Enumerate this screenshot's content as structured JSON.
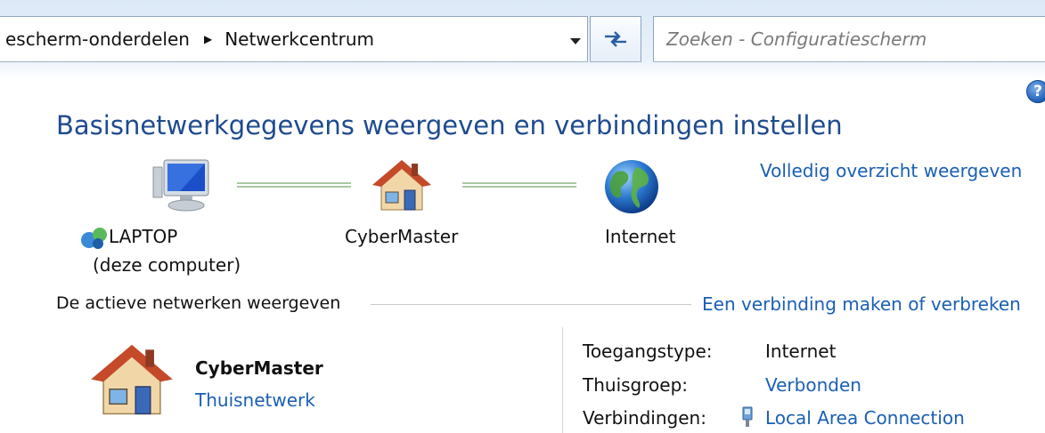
{
  "address_bar": {
    "breadcrumbs": [
      "escherm-onderdelen",
      "Netwerkcentrum"
    ],
    "search_placeholder": "Zoeken - Configuratiescherm"
  },
  "help": {
    "label": "?"
  },
  "main": {
    "title": "Basisnetwerkgegevens weergeven en verbindingen instellen",
    "overview_link": "Volledig overzicht weergeven",
    "map": {
      "computer_name": "LAPTOP",
      "computer_sub": "(deze computer)",
      "network_name": "CyberMaster",
      "internet_label": "Internet"
    },
    "active_networks": {
      "section_label": "De actieve netwerken weergeven",
      "connect_link": "Een verbinding maken of verbreken",
      "network": {
        "name": "CyberMaster",
        "type": "Thuisnetwerk"
      },
      "properties": [
        {
          "label": "Toegangstype:",
          "value": "Internet"
        },
        {
          "label": "Thuisgroep:",
          "value": "Verbonden"
        },
        {
          "label": "Verbindingen:",
          "value": "Local Area Connection"
        }
      ]
    }
  },
  "colors": {
    "title": "#1e4b8f",
    "link": "#1a5fb4",
    "connector": "#a8c9a0"
  },
  "icons": [
    "computer-icon",
    "house-icon",
    "globe-icon",
    "network-icon",
    "refresh-icon",
    "help-icon",
    "ethernet-icon"
  ]
}
